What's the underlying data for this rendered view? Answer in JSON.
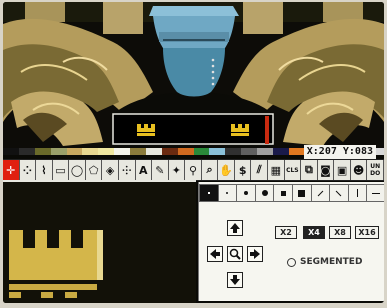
{
  "app": {
    "coords_readout": "X:207 Y:083"
  },
  "palette": [
    "#111111",
    "#2a2a2a",
    "#6a6a2a",
    "#9aa06a",
    "#c8a860",
    "#e8d890",
    "#f0e8a0",
    "#f4f4ea",
    "#8c7c3c",
    "#e8e8de",
    "#6a2a10",
    "#d06a20",
    "#2a8a3a",
    "#8ac0d8",
    "#303030",
    "#606060",
    "#a0a0a0",
    "#1a1a4a",
    "#e07820",
    "#101010",
    "#cc2a10",
    "#f2f2ea",
    "#3a3a3a",
    "#d8d8d8"
  ],
  "toolbar": {
    "tools": [
      {
        "name": "crosshair-tool",
        "icon": "✛",
        "selected": true
      },
      {
        "name": "dotted-freehand-tool",
        "icon": "⁘"
      },
      {
        "name": "curve-tool",
        "icon": "⌇"
      },
      {
        "name": "rectangle-tool",
        "icon": "▭"
      },
      {
        "name": "ellipse-tool",
        "icon": "◯"
      },
      {
        "name": "polygon-tool",
        "icon": "⬠"
      },
      {
        "name": "fill-tool",
        "icon": "◈"
      },
      {
        "name": "airbrush-tool",
        "icon": "⸭"
      },
      {
        "name": "text-tool",
        "icon": "A"
      },
      {
        "name": "brush-pick-tool",
        "icon": "✎"
      },
      {
        "name": "magic-tool",
        "icon": "✦"
      },
      {
        "name": "eyedropper-tool",
        "icon": "⚲"
      },
      {
        "name": "zoom-tool",
        "icon": "⌕"
      },
      {
        "name": "hand-tool",
        "icon": "✋"
      },
      {
        "name": "dollar-tool",
        "icon": "$"
      },
      {
        "name": "stencil-tool",
        "icon": "⫽"
      },
      {
        "name": "grid-tool",
        "icon": "▦"
      },
      {
        "name": "clear-screen-tool",
        "icon": "CLS"
      },
      {
        "name": "copy-tool",
        "icon": "⧉"
      },
      {
        "name": "camera-tool",
        "icon": "◙"
      },
      {
        "name": "disk-tool",
        "icon": "▣"
      },
      {
        "name": "person-tool",
        "icon": "☻"
      },
      {
        "name": "undo-tool",
        "icon": "UN DO"
      }
    ]
  },
  "brushes": [
    "single-dot",
    "small-dot",
    "medium-dot",
    "large-dot",
    "small-square",
    "large-square",
    "diagonal-line",
    "diagonal-line-2",
    "vertical-line",
    "horizontal-line"
  ],
  "zoom": {
    "x2": "X2",
    "x4": "X4",
    "x8": "X8",
    "x16": "X16",
    "selected": "x4",
    "segmented_label": "SEGMENTED"
  }
}
